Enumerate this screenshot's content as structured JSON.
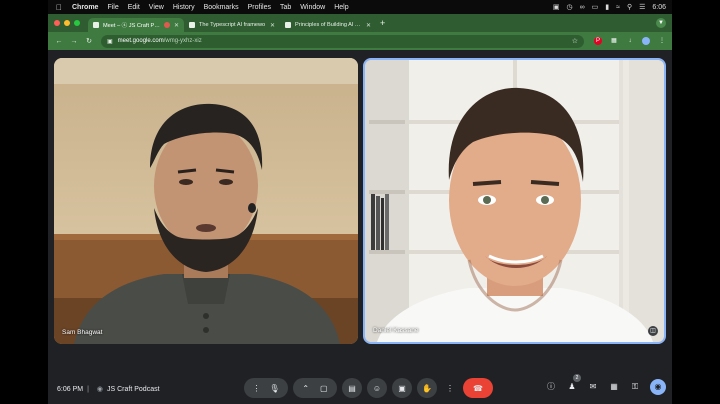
{
  "menubar": {
    "apple": "",
    "app": "Chrome",
    "items": [
      "File",
      "Edit",
      "View",
      "History",
      "Bookmarks",
      "Profiles",
      "Tab",
      "Window",
      "Help"
    ],
    "clock": "6:06"
  },
  "browser": {
    "tabs": [
      {
        "title": "Meet – ⓢ JS Craft Podca",
        "active": true
      },
      {
        "title": "The Typescript AI framewo",
        "active": false
      },
      {
        "title": "Principles of Building AI Age",
        "active": false
      }
    ],
    "new_tab": "+",
    "url_host": "meet.google.com",
    "url_path": "/wmg-yxhz-xiz"
  },
  "meet": {
    "participants": [
      {
        "name": "Sam Bhagwat"
      },
      {
        "name": "Daniel Kassane"
      }
    ],
    "time": "6:06 PM",
    "separator": "|",
    "meeting_name": "JS Craft Podcast",
    "people_count": "2"
  },
  "colors": {
    "browser_frame": "#3f7a41",
    "tabbar": "#2f5d31",
    "meet_bg": "#202124",
    "end_call": "#ea4335",
    "active_speaker_border": "#8ab4f8"
  },
  "icons": [
    "mic-icon",
    "camera-icon",
    "captions-icon",
    "emoji-icon",
    "present-icon",
    "raise-hand-icon",
    "more-icon",
    "end-call-icon",
    "info-icon",
    "people-icon",
    "chat-icon",
    "activities-icon",
    "host-controls-icon"
  ]
}
